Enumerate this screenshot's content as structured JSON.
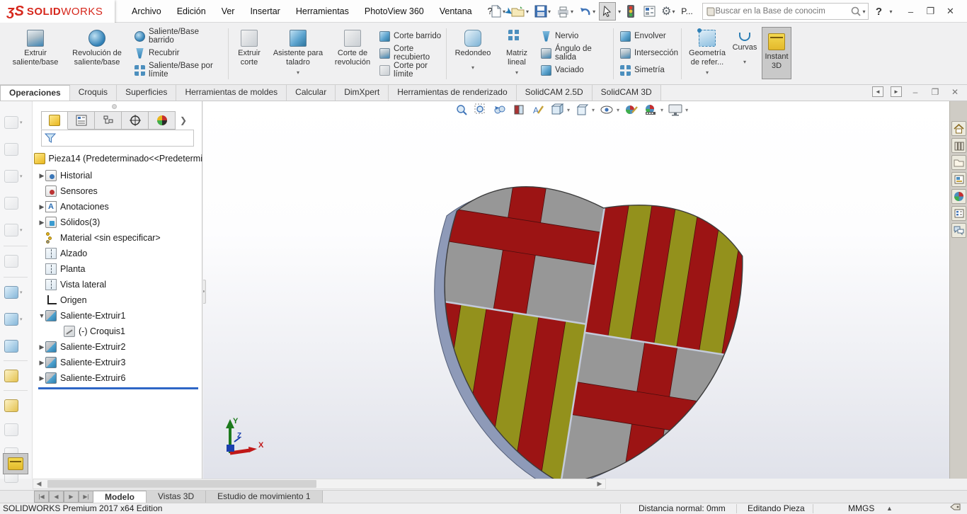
{
  "titlebar": {
    "logo_ds": "ʒS",
    "brand_bold": "SOLID",
    "brand_light": "WORKS",
    "menus": [
      "Archivo",
      "Edición",
      "Ver",
      "Insertar",
      "Herramientas",
      "PhotoView 360",
      "Ventana",
      "?"
    ],
    "p_button": "P...",
    "search_placeholder": "Buscar en la Base de conocim",
    "help_label": "?",
    "minimize": "–",
    "restore": "❐",
    "close": "✕"
  },
  "ribbon": {
    "extrude_boss": "Extruir saliente/base",
    "revolve_boss": "Revolución de saliente/base",
    "swept_boss": "Saliente/Base barrido",
    "loft": "Recubrir",
    "boundary_boss": "Saliente/Base por límite",
    "extrude_cut": "Extruir corte",
    "hole_wizard": "Asistente para taladro",
    "revolve_cut": "Corte de revolución",
    "swept_cut": "Corte barrido",
    "lofted_cut": "Corte recubierto",
    "boundary_cut": "Corte por límite",
    "fillet": "Redondeo",
    "linear_pattern": "Matriz lineal",
    "rib": "Nervio",
    "draft": "Ángulo de salida",
    "shell": "Vaciado",
    "wrap": "Envolver",
    "intersect": "Intersección",
    "mirror": "Simetría",
    "ref_geometry": "Geometría de refer...",
    "curves": "Curvas",
    "instant3d": "Instant 3D"
  },
  "ribbon_tabs": [
    "Operaciones",
    "Croquis",
    "Superficies",
    "Herramientas de moldes",
    "Calcular",
    "DimXpert",
    "Herramientas de renderizado",
    "SolidCAM 2.5D",
    "SolidCAM 3D"
  ],
  "feature_tree": {
    "root": "Pieza14  (Predeterminado<<Predetermi",
    "items": [
      "Historial",
      "Sensores",
      "Anotaciones",
      "Sólidos(3)",
      "Material <sin especificar>",
      "Alzado",
      "Planta",
      "Vista lateral",
      "Origen",
      "Saliente-Extruir1",
      "(-) Croquis1",
      "Saliente-Extruir2",
      "Saliente-Extruir3",
      "Saliente-Extruir6"
    ]
  },
  "viewport": {
    "triad": {
      "x": "X",
      "y": "Y",
      "z": "Z"
    }
  },
  "colors": {
    "shield_gray": "#979797",
    "shield_red": "#9c1414",
    "shield_yellow": "#93911c",
    "shield_edge": "#8e9ab8",
    "shield_outline": "#3c3c3c",
    "gap_line": "#c3cada"
  },
  "doc_tabs": [
    "Modelo",
    "Vistas 3D",
    "Estudio de movimiento 1"
  ],
  "statusbar": {
    "edition": "SOLIDWORKS Premium 2017 x64 Edition",
    "distance": "Distancia normal: 0mm",
    "mode": "Editando Pieza",
    "units": "MMGS"
  }
}
